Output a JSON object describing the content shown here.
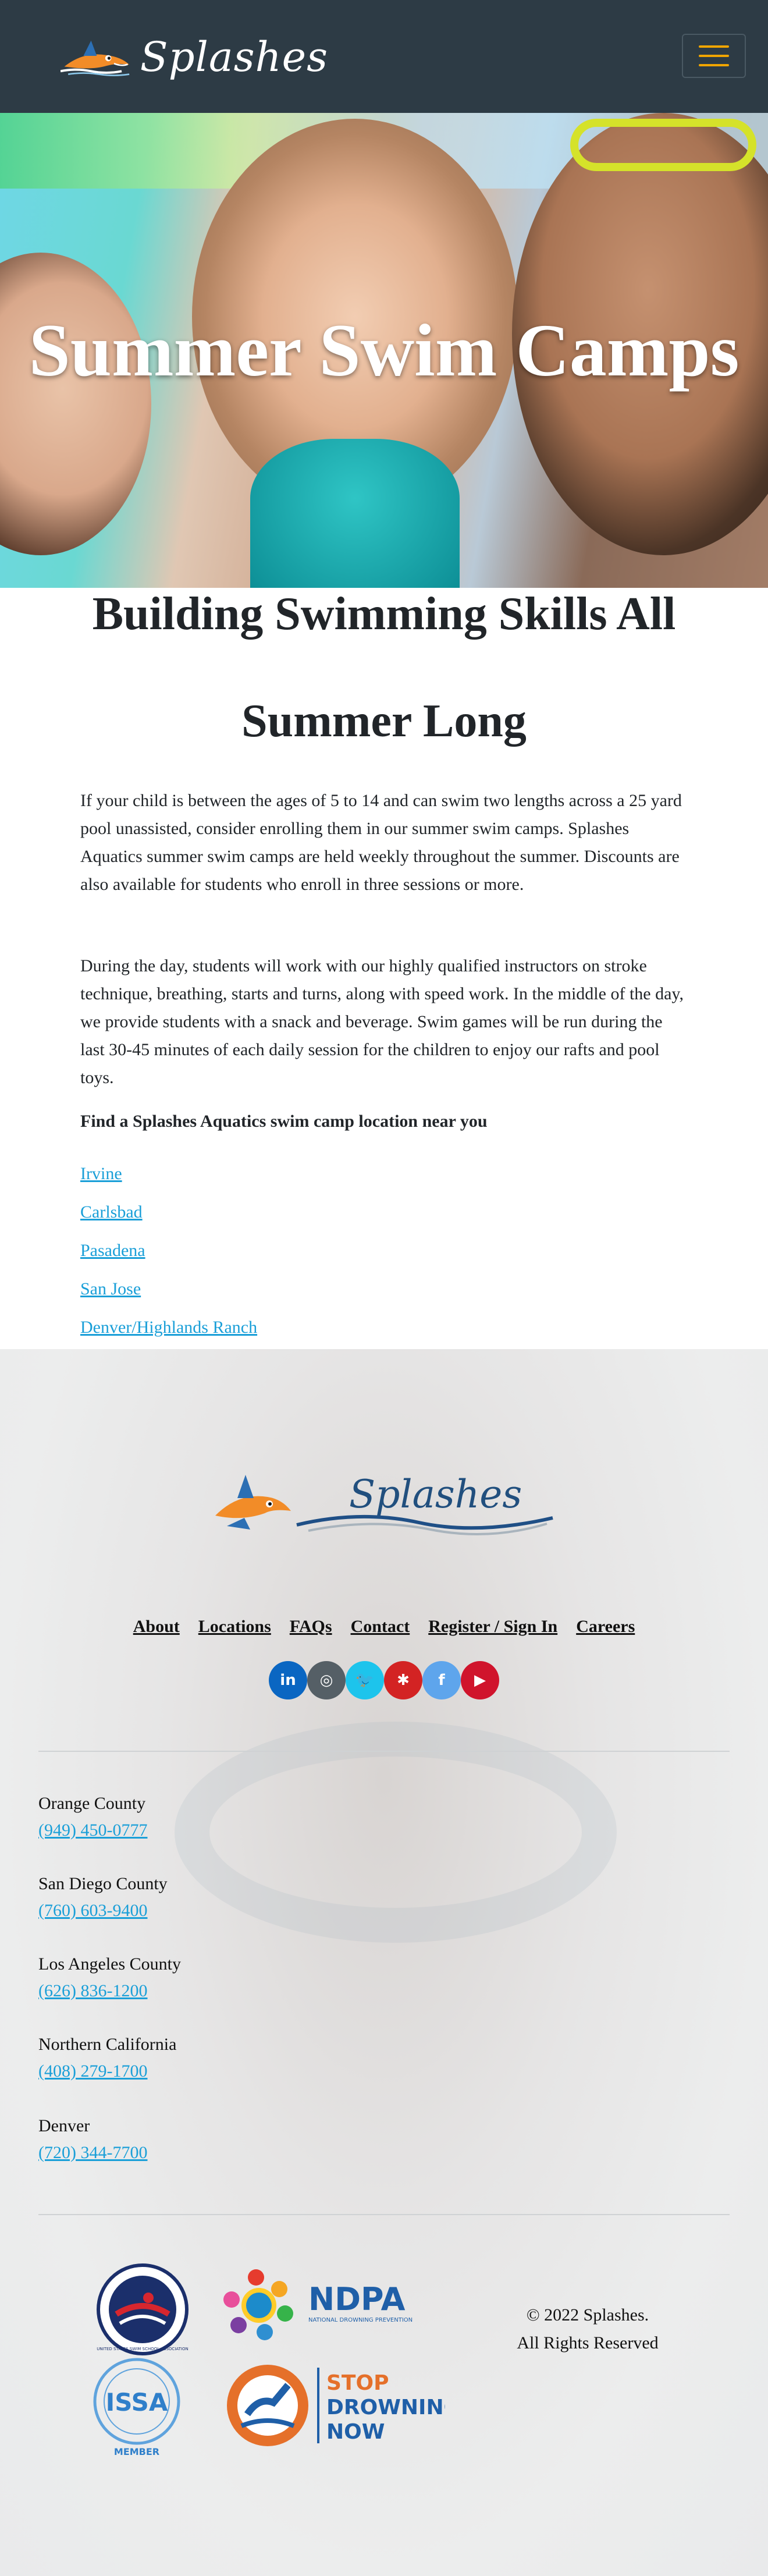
{
  "header": {
    "brand": "Splashes"
  },
  "hero": {
    "title": "Summer Swim Camps"
  },
  "main": {
    "heading_line1": "Building Swimming Skills All",
    "heading_line2": "Summer Long",
    "paragraph1": "If your child is between the ages of 5 to 14 and can swim two lengths across a 25 yard pool unassisted, consider enrolling them in our summer swim camps. Splashes Aquatics summer swim camps are held weekly throughout the summer. Discounts are also available for students who enroll in three sessions or more.",
    "paragraph2": "During the day, students will work with our highly qualified instructors on stroke technique, breathing, starts and turns, along with speed work. In the middle of the day, we provide students with a snack and beverage. Swim games will be run during the last 30-45 minutes of each daily session for the children to enjoy our rafts and pool toys.",
    "find_label": "Find a Splashes Aquatics swim camp location near you",
    "locations": [
      "Irvine",
      "Carlsbad",
      "Pasadena",
      "San Jose",
      "Denver/Highlands Ranch"
    ]
  },
  "footer": {
    "brand": "Splashes",
    "nav": [
      "About",
      "Locations",
      "FAQs",
      "Contact",
      "Register / Sign In",
      "Careers"
    ],
    "socials": [
      {
        "icon": "linkedin-icon",
        "glyph": "in",
        "color": "#0a66c2"
      },
      {
        "icon": "instagram-icon",
        "glyph": "◎",
        "color": "#555f66"
      },
      {
        "icon": "twitter-icon",
        "glyph": "🐦",
        "color": "#1dc4ec"
      },
      {
        "icon": "yelp-icon",
        "glyph": "✱",
        "color": "#d32323"
      },
      {
        "icon": "facebook-icon",
        "glyph": "f",
        "color": "#5ea5ec"
      },
      {
        "icon": "youtube-icon",
        "glyph": "▶",
        "color": "#d0142c"
      }
    ],
    "contacts": [
      {
        "region": "Orange County",
        "phone": "(949) 450-0777"
      },
      {
        "region": "San Diego County",
        "phone": "(760) 603-9400"
      },
      {
        "region": "Los Angeles County",
        "phone": "(626) 836-1200"
      },
      {
        "region": "Northern California",
        "phone": "(408) 279-1700"
      },
      {
        "region": "Denver",
        "phone": "(720) 344-7700"
      }
    ],
    "badges": {
      "ussss": "UNITED STATES SWIM SCHOOL ASSOCIATION",
      "ndpa_abbr": "NDPA",
      "ndpa_full": "NATIONAL DROWNING PREVENTION ALLIANCE",
      "issa_abbr": "ISSA",
      "issa_member": "MEMBER",
      "stop_line1": "STOP",
      "stop_line2": "DROWNING",
      "stop_line3": "NOW"
    },
    "copyright_line1": "© 2022 Splashes.",
    "copyright_line2": "All Rights Reserved"
  }
}
